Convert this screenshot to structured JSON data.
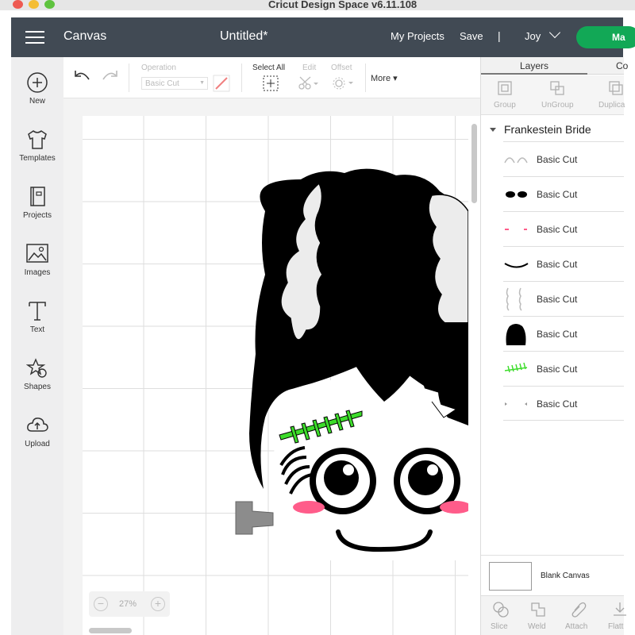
{
  "app": {
    "title": "Cricut Design Space  v6.11.108"
  },
  "header": {
    "canvas_label": "Canvas",
    "doc_title": "Untitled*",
    "my_projects": "My Projects",
    "save": "Save",
    "separator": "|",
    "user": "Joy",
    "make_label": "Ma"
  },
  "sidebar": {
    "items": [
      {
        "label": "New",
        "icon": "plus-circle-icon"
      },
      {
        "label": "Templates",
        "icon": "tshirt-icon"
      },
      {
        "label": "Projects",
        "icon": "book-icon"
      },
      {
        "label": "Images",
        "icon": "image-icon"
      },
      {
        "label": "Text",
        "icon": "text-t-icon"
      },
      {
        "label": "Shapes",
        "icon": "shapes-icon"
      },
      {
        "label": "Upload",
        "icon": "cloud-upload-icon"
      }
    ]
  },
  "toolbar": {
    "operation_label": "Operation",
    "operation_value": "Basic Cut",
    "select_all": "Select All",
    "edit": "Edit",
    "offset": "Offset",
    "more": "More"
  },
  "zoom": {
    "value": "27%",
    "minus": "−",
    "plus": "+"
  },
  "layers_panel": {
    "tabs": [
      "Layers",
      "Co"
    ],
    "tools": [
      "Group",
      "UnGroup",
      "Duplica"
    ],
    "group_name": "Frankestein Bride",
    "layers": [
      {
        "name": "Basic Cut",
        "thumb": "eye-whites"
      },
      {
        "name": "Basic Cut",
        "thumb": "eyelashes"
      },
      {
        "name": "Basic Cut",
        "thumb": "cheeks"
      },
      {
        "name": "Basic Cut",
        "thumb": "smile"
      },
      {
        "name": "Basic Cut",
        "thumb": "hair-streaks"
      },
      {
        "name": "Basic Cut",
        "thumb": "hair"
      },
      {
        "name": "Basic Cut",
        "thumb": "stitches"
      },
      {
        "name": "Basic Cut",
        "thumb": "bolts"
      }
    ],
    "blank_canvas": "Blank Canvas",
    "bottom_tools": [
      "Slice",
      "Weld",
      "Attach",
      "Flatt"
    ]
  },
  "colors": {
    "header_bg": "#414a54",
    "make_button": "#12a856",
    "stitch_green": "#3ddc2b",
    "cheek_pink": "#ff5c8a",
    "bolt_gray": "#8c8c8c"
  }
}
